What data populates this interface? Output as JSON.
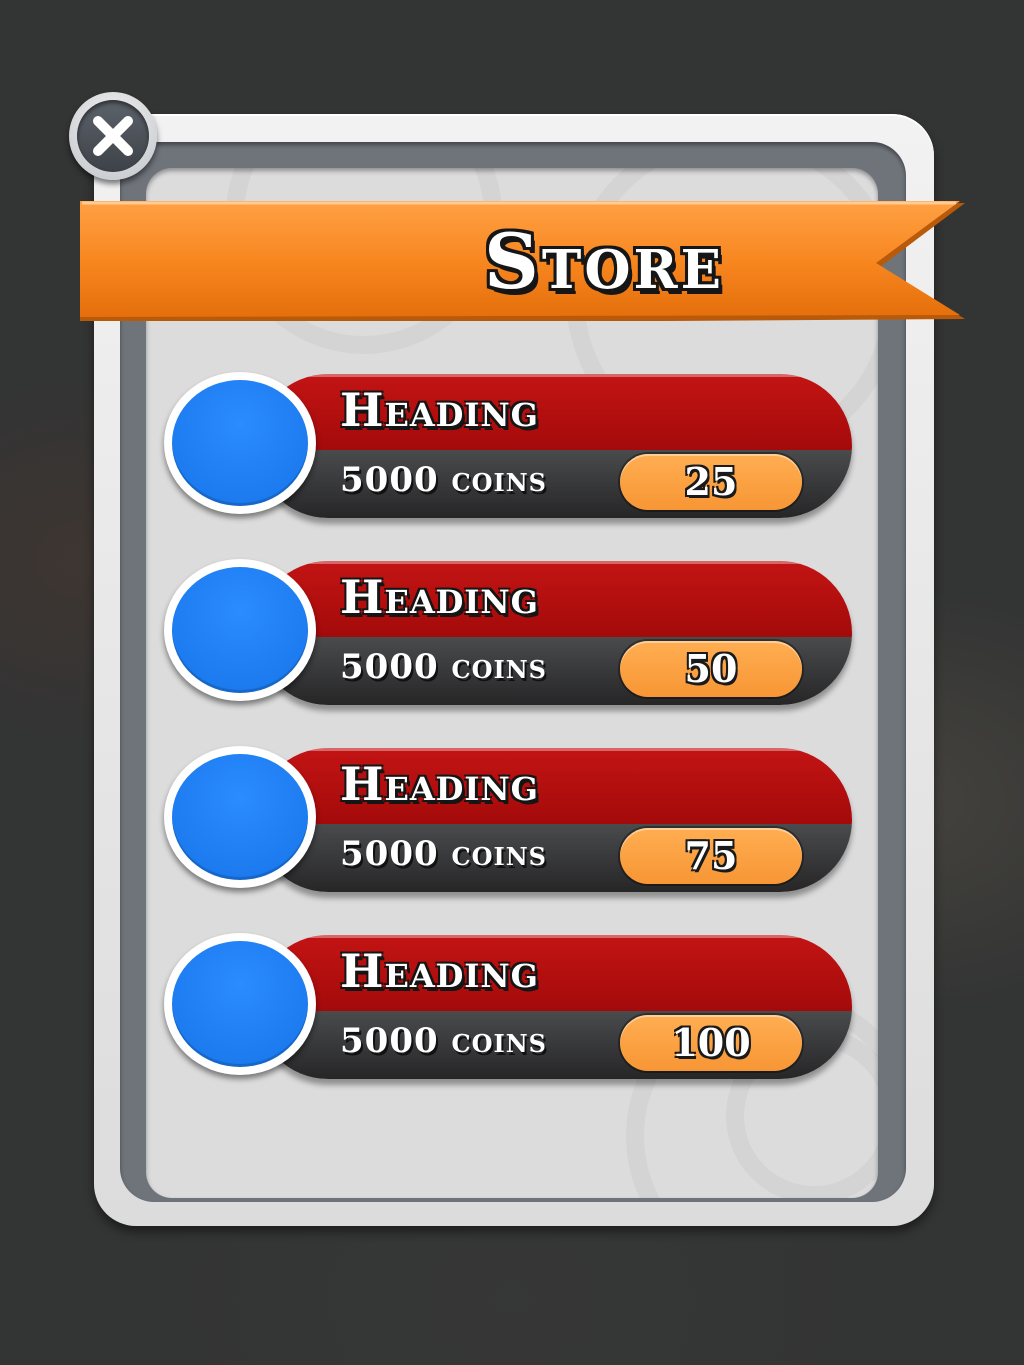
{
  "store": {
    "title": "Store",
    "close_icon": "close-icon",
    "items": [
      {
        "heading": "Heading",
        "coins": "5000 coins",
        "price": "25",
        "icon": "item-icon"
      },
      {
        "heading": "Heading",
        "coins": "5000 coins",
        "price": "50",
        "icon": "item-icon"
      },
      {
        "heading": "Heading",
        "coins": "5000 coins",
        "price": "75",
        "icon": "item-icon"
      },
      {
        "heading": "Heading",
        "coins": "5000 coins",
        "price": "100",
        "icon": "item-icon"
      }
    ]
  },
  "colors": {
    "ribbon": "#f7851e",
    "item_header": "#b30f0f",
    "item_footer": "#333435",
    "price_button": "#fba145",
    "icon": "#1f82f7",
    "panel": "#dcdcdc"
  }
}
